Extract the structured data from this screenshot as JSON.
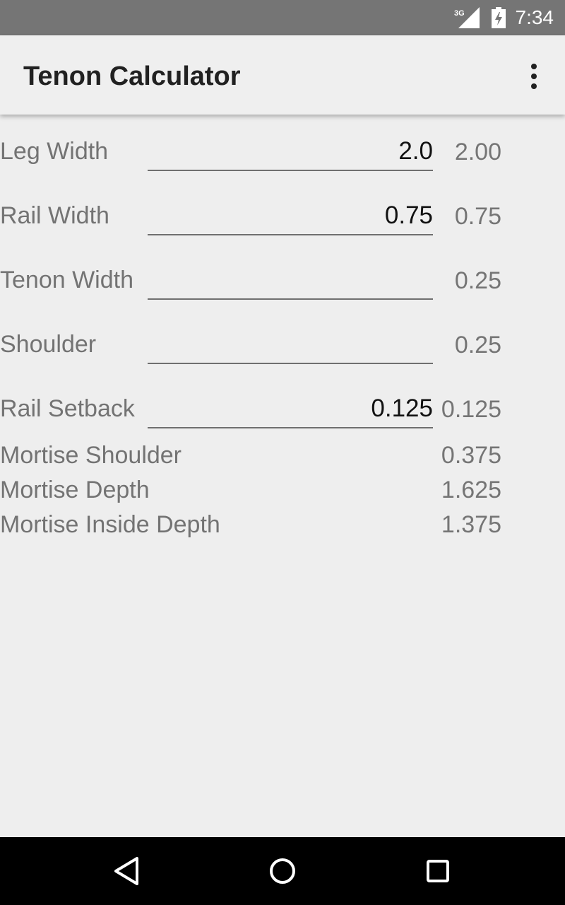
{
  "status_bar": {
    "network": "3G",
    "time": "7:34",
    "icons": [
      "signal-icon",
      "battery-icon"
    ]
  },
  "app_bar": {
    "title": "Tenon Calculator",
    "overflow_icon": "more-vert-icon"
  },
  "inputs": [
    {
      "label": "Leg Width",
      "value": "2.0",
      "result": "2.00"
    },
    {
      "label": "Rail Width",
      "value": "0.75",
      "result": "0.75"
    },
    {
      "label": "Tenon Width",
      "value": "",
      "result": "0.25"
    },
    {
      "label": "Shoulder",
      "value": "",
      "result": "0.25"
    },
    {
      "label": "Rail Setback",
      "value": "0.125",
      "result": "0.125"
    }
  ],
  "outputs": [
    {
      "label": "Mortise Shoulder",
      "result": "0.375"
    },
    {
      "label": "Mortise Depth",
      "result": "1.625"
    },
    {
      "label": "Mortise Inside Depth",
      "result": "1.375"
    }
  ],
  "nav_bar": {
    "icons": [
      "back-icon",
      "home-icon",
      "recents-icon"
    ]
  }
}
